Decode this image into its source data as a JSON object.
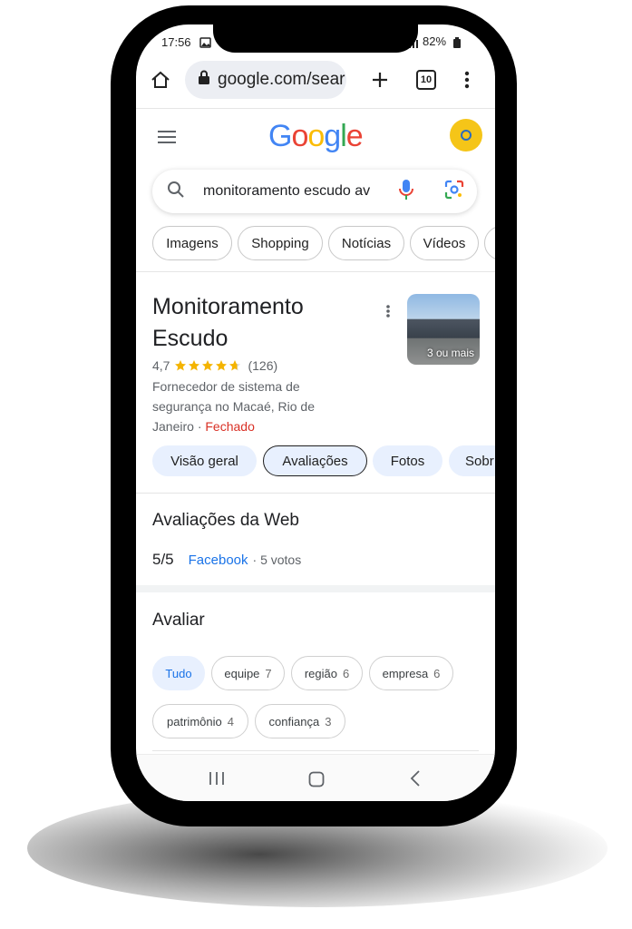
{
  "status": {
    "time": "17:56",
    "battery": "82%"
  },
  "browser": {
    "url": "google.com/sear",
    "tab_count": "10"
  },
  "search": {
    "query": "monitoramento escudo av"
  },
  "filters": [
    "Imagens",
    "Shopping",
    "Notícias",
    "Vídeos"
  ],
  "business": {
    "name_line1": "Monitoramento",
    "name_line2": "Escudo",
    "rating": "4,7",
    "stars": 4.7,
    "review_count": "(126)",
    "description": "Fornecedor de sistema de segurança no Macaé, Rio de Janeiro",
    "separator": "·",
    "status": "Fechado",
    "photo_label": "3 ou mais"
  },
  "tabs": [
    "Visão geral",
    "Avaliações",
    "Fotos",
    "Sobr"
  ],
  "web_reviews": {
    "heading": "Avaliações da Web",
    "score": "5/5",
    "source": "Facebook",
    "votes": "· 5 votos"
  },
  "rate": {
    "heading": "Avaliar",
    "chips": [
      {
        "label": "Tudo"
      },
      {
        "label": "equipe",
        "count": "7"
      },
      {
        "label": "região",
        "count": "6"
      },
      {
        "label": "empresa",
        "count": "6"
      },
      {
        "label": "patrimônio",
        "count": "4"
      },
      {
        "label": "confiança",
        "count": "3"
      }
    ]
  },
  "colors": {
    "accent_blue": "#1a73e8",
    "closed_red": "#d93025",
    "link_blue": "#1a0dab",
    "tab_bg": "#e8f0fe"
  }
}
